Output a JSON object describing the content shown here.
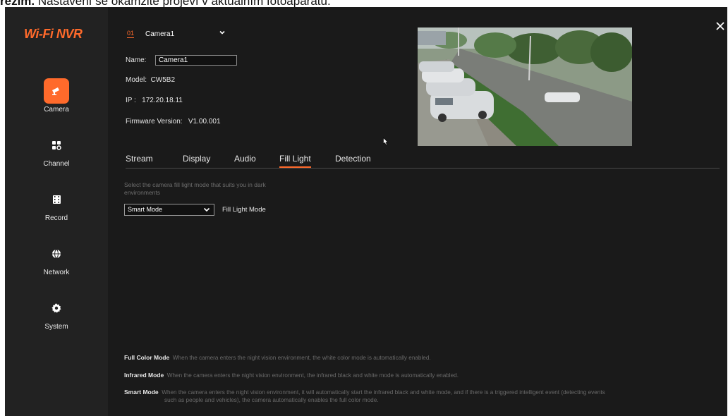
{
  "caption": {
    "bold": "režim.",
    "text": " Nastavení se okamžitě projeví v aktuálním fotoaparátu."
  },
  "app": {
    "logo": "Wi-Fi NVR",
    "colors": {
      "accent": "#ff6a2b",
      "background": "#1a1a1a",
      "sidebar": "#222222"
    }
  },
  "sidebar": {
    "items": [
      {
        "label": "Camera",
        "icon": "camera-icon",
        "active": true
      },
      {
        "label": "Channel",
        "icon": "channel-grid-icon",
        "active": false
      },
      {
        "label": "Record",
        "icon": "record-film-icon",
        "active": false
      },
      {
        "label": "Network",
        "icon": "globe-icon",
        "active": false
      },
      {
        "label": "System",
        "icon": "gear-icon",
        "active": false
      }
    ]
  },
  "camera": {
    "number": "01",
    "selected": "Camera1",
    "name_label": "Name:",
    "name_value": "Camera1",
    "model_label": "Model:",
    "model_value": "CW5B2",
    "ip_label": "IP :",
    "ip_value": "172.20.18.11",
    "firmware_label": "Firmware Version:",
    "firmware_value": "V1.00.001"
  },
  "tabs": [
    {
      "label": "Stream",
      "active": false
    },
    {
      "label": "Display",
      "active": false
    },
    {
      "label": "Audio",
      "active": false
    },
    {
      "label": "Fill Light",
      "active": true
    },
    {
      "label": "Detection",
      "active": false
    }
  ],
  "fill_light": {
    "description": "Select the camera fill light mode that suits you in dark environments",
    "mode_value": "Smart Mode",
    "mode_label": "Fill Light Mode"
  },
  "notes": [
    {
      "title": "Full Color Mode",
      "text": "When the camera enters the night vision environment, the white color mode is automatically enabled."
    },
    {
      "title": "Infrared Mode",
      "text": "When the camera enters the night vision environment, the infrared black and white mode is automatically enabled."
    },
    {
      "title": "Smart Mode",
      "text": "When the camera enters the night vision environment, it will automatically start the infrared black and white mode, and if there is a triggered intelligent event (detecting events",
      "text2": "such as people and vehicles), the camera automatically enables the full color mode."
    }
  ]
}
